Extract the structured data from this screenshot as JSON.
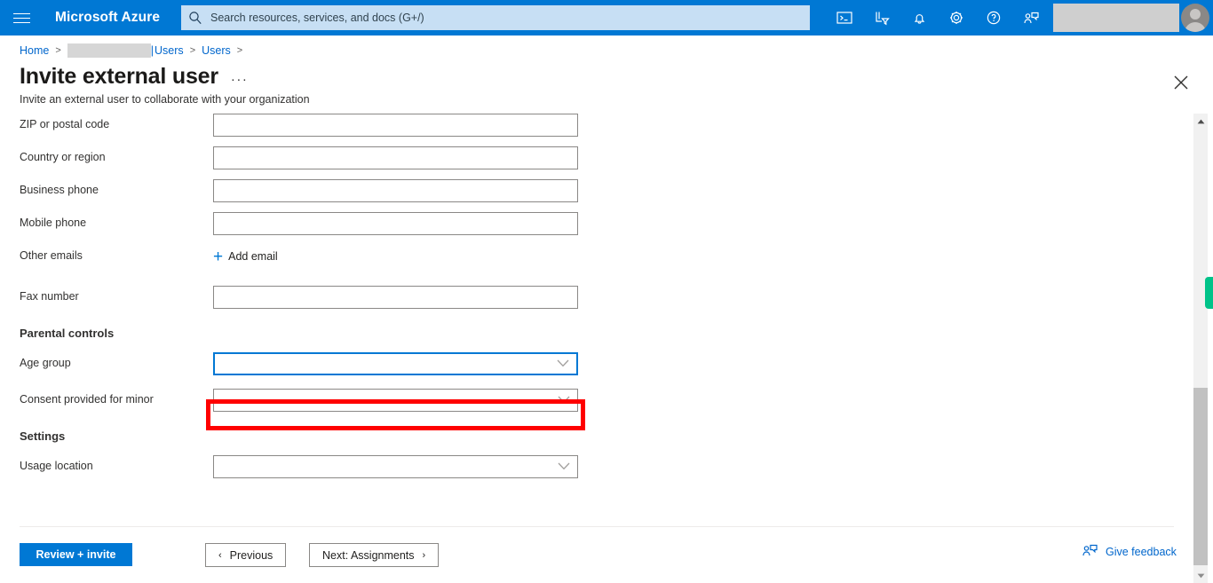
{
  "topbar": {
    "menu_icon": "hamburger-icon",
    "brand": "Microsoft Azure",
    "search": {
      "icon": "search-icon",
      "placeholder": "Search resources, services, and docs (G+/)",
      "value": ""
    },
    "icons": [
      {
        "name": "cloud-shell-icon",
        "label": "Cloud Shell"
      },
      {
        "name": "directory-filter-icon",
        "label": "Directories + subscriptions"
      },
      {
        "name": "notifications-bell-icon",
        "label": "Notifications"
      },
      {
        "name": "settings-gear-icon",
        "label": "Settings"
      },
      {
        "name": "help-question-icon",
        "label": "Help"
      },
      {
        "name": "feedback-person-icon",
        "label": "Feedback"
      }
    ],
    "account_redacted": "",
    "avatar": "user-avatar"
  },
  "breadcrumb": {
    "home": "Home",
    "redacted": "",
    "pipe": "|",
    "item2": "Users",
    "item3": "Users",
    "separator": ">"
  },
  "header": {
    "title": "Invite external user",
    "more_label": "···",
    "subtitle": "Invite an external user to collaborate with your organization",
    "close_label": "Close"
  },
  "form": {
    "fields": [
      {
        "label": "ZIP or postal code",
        "type": "text",
        "value": "",
        "placeholder": ""
      },
      {
        "label": "Country or region",
        "type": "text",
        "value": "",
        "placeholder": ""
      },
      {
        "label": "Business phone",
        "type": "text",
        "value": "",
        "placeholder": ""
      },
      {
        "label": "Mobile phone",
        "type": "text",
        "value": "",
        "placeholder": ""
      }
    ],
    "other_emails": {
      "label": "Other emails",
      "add_label": "Add email",
      "plus": "+"
    },
    "fax": {
      "label": "Fax number",
      "type": "text",
      "value": "",
      "placeholder": ""
    },
    "parental_controls": {
      "heading": "Parental controls",
      "age_group": {
        "label": "Age group",
        "value": "",
        "focused": true
      },
      "consent": {
        "label": "Consent provided for minor",
        "value": "",
        "highlighted": true
      }
    },
    "settings": {
      "heading": "Settings",
      "usage_location": {
        "label": "Usage location",
        "value": ""
      }
    }
  },
  "footer": {
    "review_invite": "Review + invite",
    "previous": "Previous",
    "previous_chevron": "‹",
    "next": "Next: Assignments",
    "next_chevron": "›",
    "give_feedback": "Give feedback",
    "feedback_icon": "feedback-person-icon"
  },
  "scrollbar": {
    "up_arrow": "scroll-up-arrow-icon",
    "down_arrow": "scroll-down-arrow-icon",
    "thumb": "scrollbar-thumb"
  },
  "annotation": {
    "color": "#ff0000",
    "target": "consent-provided-for-minor-dropdown"
  },
  "colors": {
    "accent": "#0078d4",
    "link": "#0066cc",
    "highlight": "#ff0000",
    "green_tab": "#00c389"
  }
}
